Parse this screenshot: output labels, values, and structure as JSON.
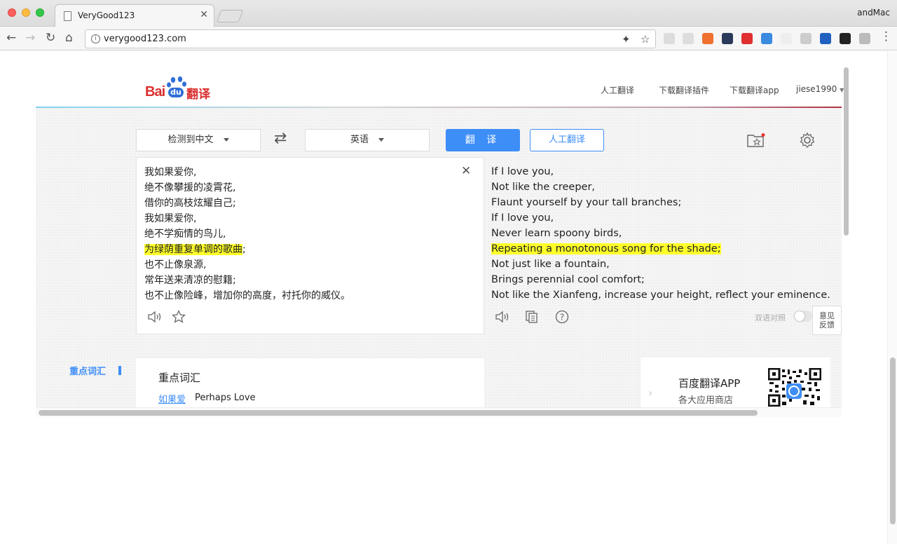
{
  "browser": {
    "tab_title": "VeryGood123",
    "tab_close": "✕",
    "profile_name": "andMac",
    "url": "verygood123.com",
    "info_glyph": "i"
  },
  "header": {
    "logo_bai": "Bai",
    "logo_du": "du",
    "logo_suffix": "翻译",
    "nav": [
      "人工翻译",
      "下载翻译插件",
      "下载翻译app",
      "jiese1990"
    ]
  },
  "controls": {
    "source_lang": "检测到中文",
    "target_lang": "英语",
    "translate_button": "翻 译",
    "human_translate_button": "人工翻译",
    "swap_glyph": "⇄"
  },
  "source": {
    "lines": [
      "我如果爱你,",
      "绝不像攀援的凌霄花,",
      "借你的高枝炫耀自己;",
      "我如果爱你,",
      "绝不学痴情的鸟儿,",
      "为绿荫重复单调的歌曲",
      "也不止像泉源,",
      "常年送来清凉的慰籍;",
      "也不止像险峰，增加你的高度，衬托你的威仪。"
    ],
    "highlight_suffix": ";",
    "clear_glyph": "✕"
  },
  "target": {
    "lines": [
      "If I love you,",
      "Not like the creeper,",
      "Flaunt yourself by your tall branches;",
      "If I love you,",
      "Never learn spoony birds,",
      "Repeating a monotonous song for the shade;",
      "Not just like a fountain,",
      "Brings perennial cool comfort;",
      "Not like the Xianfeng, increase your height, reflect your eminence."
    ],
    "bilingual_label": "双语对照",
    "feedback_line1": "意见",
    "feedback_line2": "反馈"
  },
  "vocab": {
    "section_label": "重点词汇",
    "title": "重点词汇",
    "word": "如果爱",
    "definition": "Perhaps Love"
  },
  "app_promo": {
    "name": "百度翻译APP",
    "subtitle": "各大应用商店",
    "arrow": "›"
  },
  "icons": {
    "speaker": "speaker-icon",
    "star": "star-icon",
    "copy": "copy-icon",
    "help": "help-icon",
    "gear": "gear-icon",
    "favorites": "favorites-folder-icon"
  },
  "colors": {
    "accent": "#3e8ef7",
    "brand_red": "#d92f2f",
    "highlight": "#ffff2a"
  }
}
